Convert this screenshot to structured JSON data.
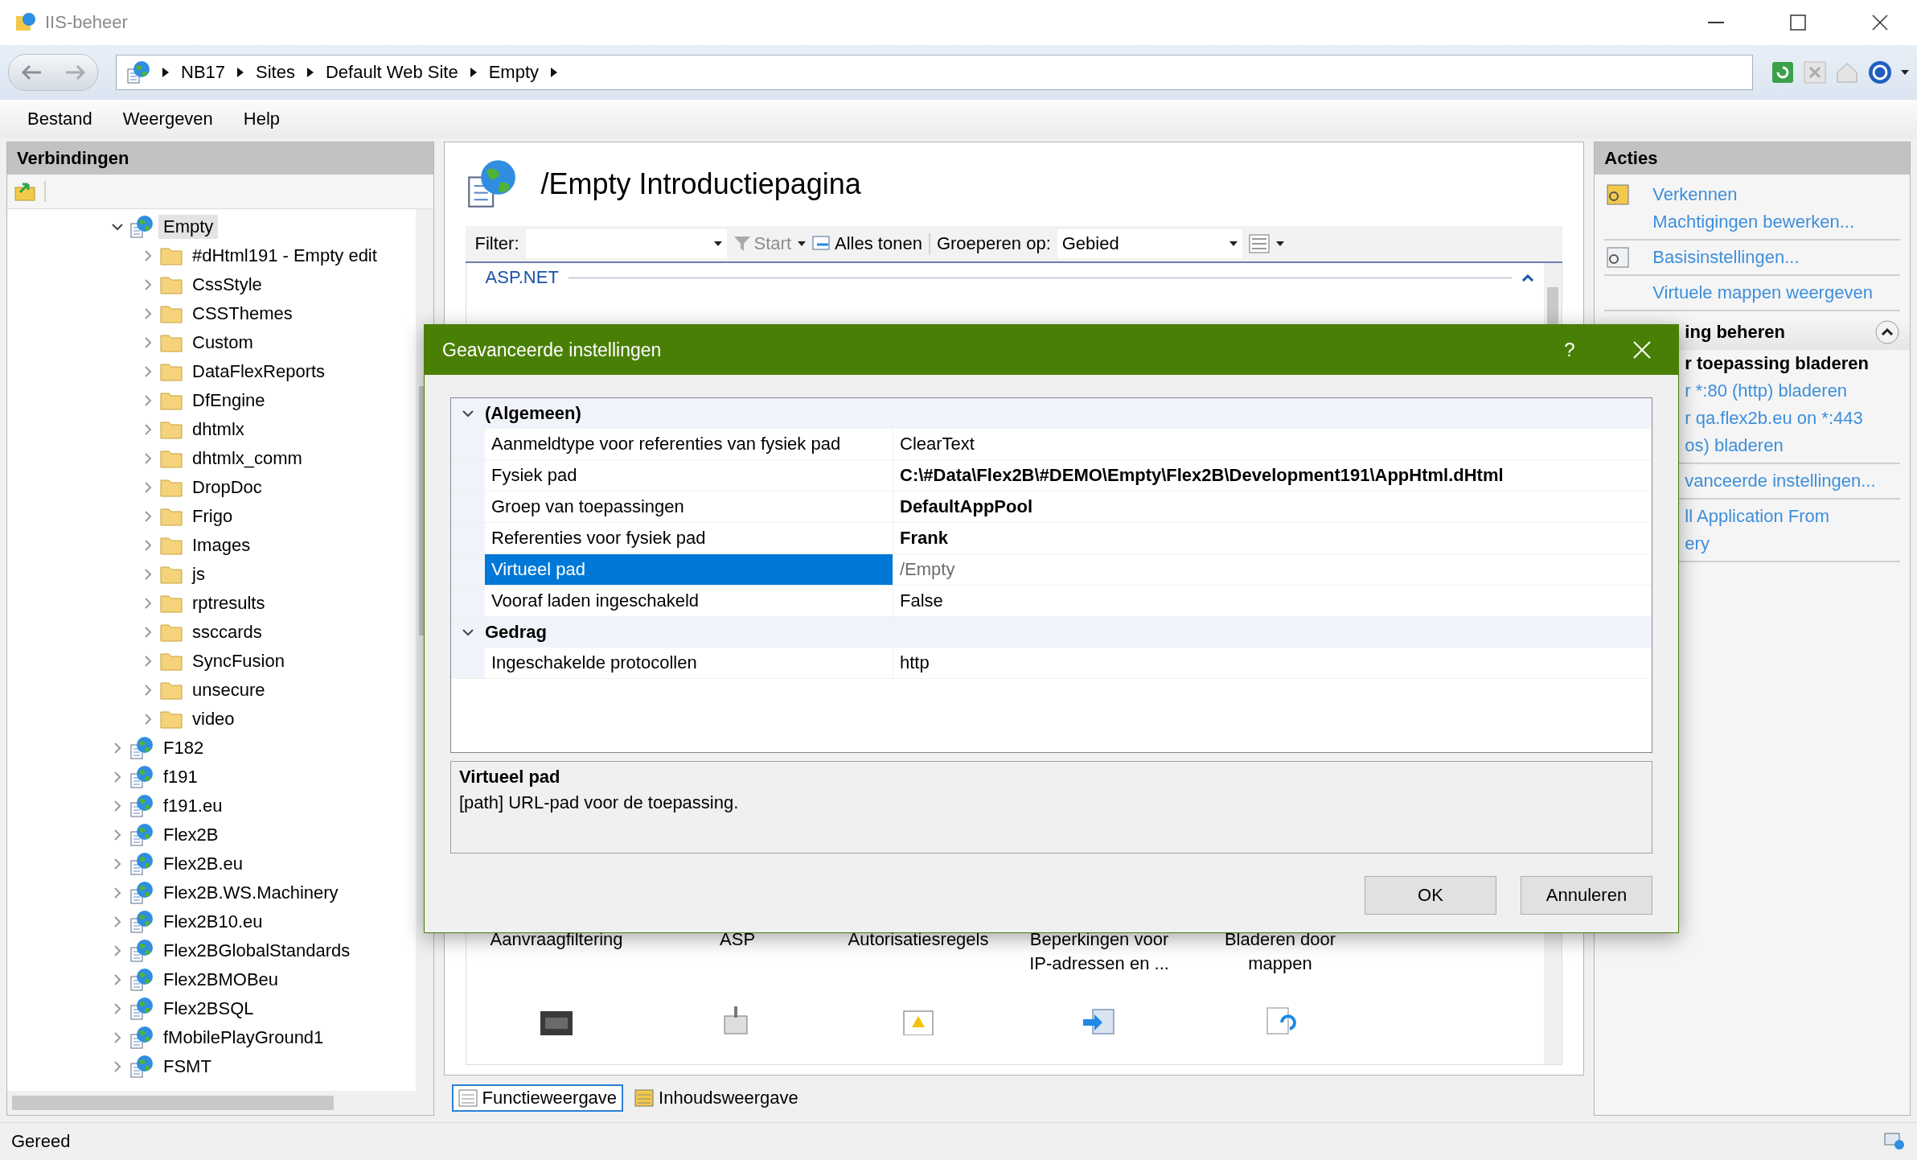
{
  "window": {
    "title": "IIS-beheer"
  },
  "address_bar": {
    "crumbs": [
      "NB17",
      "Sites",
      "Default Web Site",
      "Empty"
    ]
  },
  "menu": [
    "Bestand",
    "Weergeven",
    "Help"
  ],
  "connections": {
    "title": "Verbindingen",
    "tree": [
      {
        "label": "Empty",
        "kind": "site",
        "expanded": true,
        "selected": true,
        "children": [
          {
            "label": "#dHtml191 - Empty edit",
            "kind": "folder",
            "expanded": false,
            "selected": false
          },
          {
            "label": "CssStyle",
            "kind": "folder",
            "expanded": false,
            "selected": false
          },
          {
            "label": "CSSThemes",
            "kind": "folder",
            "expanded": false,
            "selected": false
          },
          {
            "label": "Custom",
            "kind": "folder",
            "expanded": false,
            "selected": false
          },
          {
            "label": "DataFlexReports",
            "kind": "folder",
            "expanded": false,
            "selected": false
          },
          {
            "label": "DfEngine",
            "kind": "folder",
            "expanded": false,
            "selected": false
          },
          {
            "label": "dhtmlx",
            "kind": "folder",
            "expanded": false,
            "selected": false
          },
          {
            "label": "dhtmlx_comm",
            "kind": "folder",
            "expanded": false,
            "selected": false
          },
          {
            "label": "DropDoc",
            "kind": "folder",
            "expanded": false,
            "selected": false
          },
          {
            "label": "Frigo",
            "kind": "folder",
            "expanded": false,
            "selected": false
          },
          {
            "label": "Images",
            "kind": "folder",
            "expanded": false,
            "selected": false
          },
          {
            "label": "js",
            "kind": "folder",
            "expanded": false,
            "selected": false
          },
          {
            "label": "rptresults",
            "kind": "folder",
            "expanded": false,
            "selected": false
          },
          {
            "label": "ssccards",
            "kind": "folder",
            "expanded": false,
            "selected": false
          },
          {
            "label": "SyncFusion",
            "kind": "folder",
            "expanded": false,
            "selected": false
          },
          {
            "label": "unsecure",
            "kind": "folder",
            "expanded": false,
            "selected": false
          },
          {
            "label": "video",
            "kind": "folder",
            "expanded": false,
            "selected": false
          }
        ]
      },
      {
        "label": "F182",
        "kind": "site",
        "expanded": false,
        "selected": false
      },
      {
        "label": "f191",
        "kind": "site",
        "expanded": false,
        "selected": false
      },
      {
        "label": "f191.eu",
        "kind": "site",
        "expanded": false,
        "selected": false
      },
      {
        "label": "Flex2B",
        "kind": "site",
        "expanded": false,
        "selected": false
      },
      {
        "label": "Flex2B.eu",
        "kind": "site",
        "expanded": false,
        "selected": false
      },
      {
        "label": "Flex2B.WS.Machinery",
        "kind": "site",
        "expanded": false,
        "selected": false
      },
      {
        "label": "Flex2B10.eu",
        "kind": "site",
        "expanded": false,
        "selected": false
      },
      {
        "label": "Flex2BGlobalStandards",
        "kind": "site",
        "expanded": false,
        "selected": false
      },
      {
        "label": "Flex2BMOBeu",
        "kind": "site",
        "expanded": false,
        "selected": false
      },
      {
        "label": "Flex2BSQL",
        "kind": "site",
        "expanded": false,
        "selected": false
      },
      {
        "label": "fMobilePlayGround1",
        "kind": "site",
        "expanded": false,
        "selected": false
      },
      {
        "label": "FSMT",
        "kind": "site",
        "expanded": false,
        "selected": false
      }
    ]
  },
  "content": {
    "title": "/Empty Introductiepagina",
    "filter": {
      "label": "Filter:",
      "start": {
        "label": "Start",
        "disabled": true
      },
      "show_all": "Alles tonen",
      "group_label": "Groeperen op:",
      "group_value": "Gebied"
    },
    "group": {
      "label": "ASP.NET",
      "expanded": true
    },
    "features": [
      "Aanvraagfiltering",
      "ASP",
      "Autorisatiesregels",
      "Beperkingen voor IP-adressen en ...",
      "Bladeren door mappen"
    ],
    "tabs": [
      {
        "label": "Functieweergave",
        "selected": true
      },
      {
        "label": "Inhoudsweergave",
        "selected": false
      }
    ]
  },
  "actions": {
    "title": "Acties",
    "groups": [
      [
        {
          "kind": "icon-link",
          "label": "Verkennen"
        },
        {
          "kind": "link",
          "label": "Machtigingen bewerken..."
        }
      ],
      [
        {
          "kind": "icon-link",
          "label": "Basisinstellingen..."
        }
      ],
      [
        {
          "kind": "link",
          "label": "Virtuele mappen weergeven"
        }
      ],
      [
        {
          "kind": "section",
          "label": "ing beheren",
          "expanded": true
        },
        {
          "kind": "heading",
          "label": "r toepassing bladeren"
        },
        {
          "kind": "partial-link",
          "label": "r *:80 (http) bladeren"
        },
        {
          "kind": "partial-link",
          "label": "r qa.flex2b.eu on *:443"
        },
        {
          "kind": "partial-link",
          "label": "os) bladeren"
        }
      ],
      [
        {
          "kind": "partial-link",
          "label": "vanceerde instellingen..."
        }
      ],
      [
        {
          "kind": "partial-link",
          "label": "ll Application From"
        },
        {
          "kind": "partial-link",
          "label": "ery"
        }
      ]
    ]
  },
  "status_bar": "Gereed",
  "dialog": {
    "title": "Geavanceerde instellingen",
    "help": "?",
    "categories": [
      {
        "name": "(Algemeen)",
        "expanded": true,
        "properties": [
          {
            "name": "Aanmeldtype voor referenties van fysiek pad",
            "value": "ClearText",
            "modified": false,
            "selected": false,
            "editing": false
          },
          {
            "name": "Fysiek pad",
            "value": "C:\\#Data\\Flex2B\\#DEMO\\Empty\\Flex2B\\Development191\\AppHtml.dHtml",
            "modified": true,
            "selected": false,
            "editing": false
          },
          {
            "name": "Groep van toepassingen",
            "value": "DefaultAppPool",
            "modified": true,
            "selected": false,
            "editing": false
          },
          {
            "name": "Referenties voor fysiek pad",
            "value": "Frank",
            "modified": true,
            "selected": false,
            "editing": false
          },
          {
            "name": "Virtueel pad",
            "value": "/Empty",
            "modified": false,
            "selected": true,
            "editing": true
          },
          {
            "name": "Vooraf laden ingeschakeld",
            "value": "False",
            "modified": false,
            "selected": false,
            "editing": false
          }
        ]
      },
      {
        "name": "Gedrag",
        "expanded": true,
        "properties": [
          {
            "name": "Ingeschakelde protocollen",
            "value": "http",
            "modified": false,
            "selected": false,
            "editing": false
          }
        ]
      }
    ],
    "description": {
      "title": "Virtueel pad",
      "text": "[path] URL-pad voor de toepassing."
    },
    "buttons": [
      "OK",
      "Annuleren"
    ]
  }
}
